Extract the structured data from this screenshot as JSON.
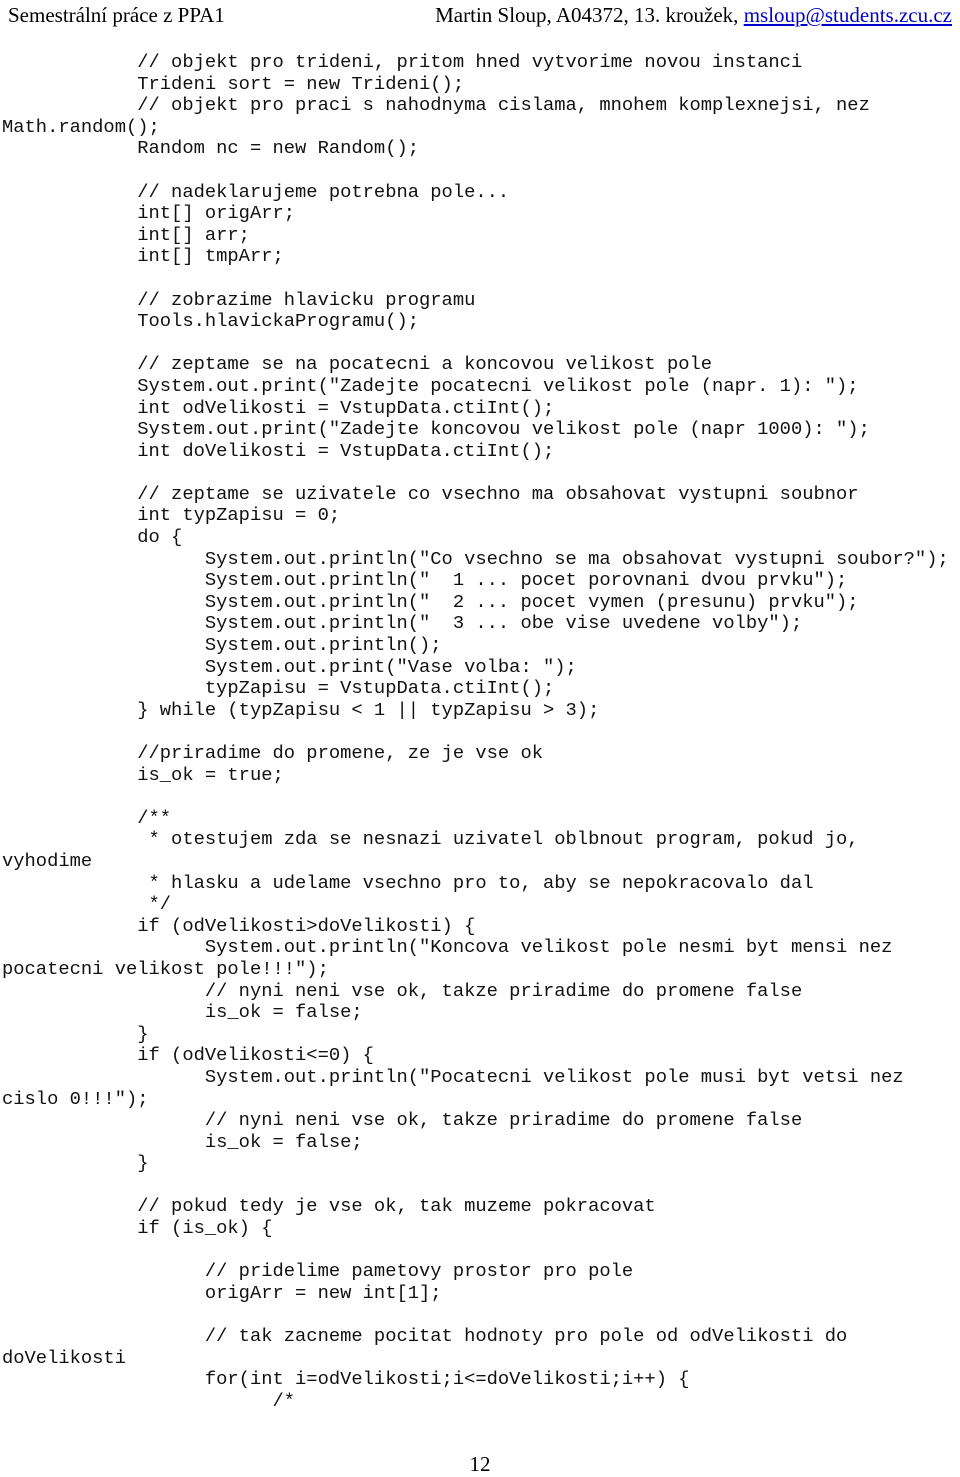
{
  "header": {
    "title": "Semestrální práce z PPA1",
    "author_info": "Martin Sloup, A04372, 13. kroužek, ",
    "email": "msloup@students.zcu.cz"
  },
  "code_lines": [
    "            // objekt pro trideni, pritom hned vytvorime novou instanci",
    "            Trideni sort = new Trideni();",
    "            // objekt pro praci s nahodnyma cislama, mnohem komplexnejsi, nez",
    "Math.random();",
    "            Random nc = new Random();",
    "",
    "            // nadeklarujeme potrebna pole...",
    "            int[] origArr;",
    "            int[] arr;",
    "            int[] tmpArr;",
    "",
    "            // zobrazime hlavicku programu",
    "            Tools.hlavickaProgramu();",
    "",
    "            // zeptame se na pocatecni a koncovou velikost pole",
    "            System.out.print(\"Zadejte pocatecni velikost pole (napr. 1): \");",
    "            int odVelikosti = VstupData.ctiInt();",
    "            System.out.print(\"Zadejte koncovou velikost pole (napr 1000): \");",
    "            int doVelikosti = VstupData.ctiInt();",
    "",
    "            // zeptame se uzivatele co vsechno ma obsahovat vystupni soubnor",
    "            int typZapisu = 0;",
    "            do {",
    "                  System.out.println(\"Co vsechno se ma obsahovat vystupni soubor?\");",
    "                  System.out.println(\"  1 ... pocet porovnani dvou prvku\");",
    "                  System.out.println(\"  2 ... pocet vymen (presunu) prvku\");",
    "                  System.out.println(\"  3 ... obe vise uvedene volby\");",
    "                  System.out.println();",
    "                  System.out.print(\"Vase volba: \");",
    "                  typZapisu = VstupData.ctiInt();",
    "            } while (typZapisu < 1 || typZapisu > 3);",
    "",
    "            //priradime do promene, ze je vse ok",
    "            is_ok = true;",
    "",
    "            /**",
    "             * otestujem zda se nesnazi uzivatel oblbnout program, pokud jo,",
    "vyhodime",
    "             * hlasku a udelame vsechno pro to, aby se nepokracovalo dal",
    "             */",
    "            if (odVelikosti>doVelikosti) {",
    "                  System.out.println(\"Koncova velikost pole nesmi byt mensi nez",
    "pocatecni velikost pole!!!\");",
    "                  // nyni neni vse ok, takze priradime do promene false",
    "                  is_ok = false;",
    "            }",
    "            if (odVelikosti<=0) {",
    "                  System.out.println(\"Pocatecni velikost pole musi byt vetsi nez",
    "cislo 0!!!\");",
    "                  // nyni neni vse ok, takze priradime do promene false",
    "                  is_ok = false;",
    "            }",
    "",
    "            // pokud tedy je vse ok, tak muzeme pokracovat",
    "            if (is_ok) {",
    "",
    "                  // pridelime pametovy prostor pro pole",
    "                  origArr = new int[1];",
    "",
    "                  // tak zacneme pocitat hodnoty pro pole od odVelikosti do",
    "doVelikosti",
    "                  for(int i=odVelikosti;i<=doVelikosti;i++) {",
    "                        /*"
  ],
  "page_number": "12"
}
